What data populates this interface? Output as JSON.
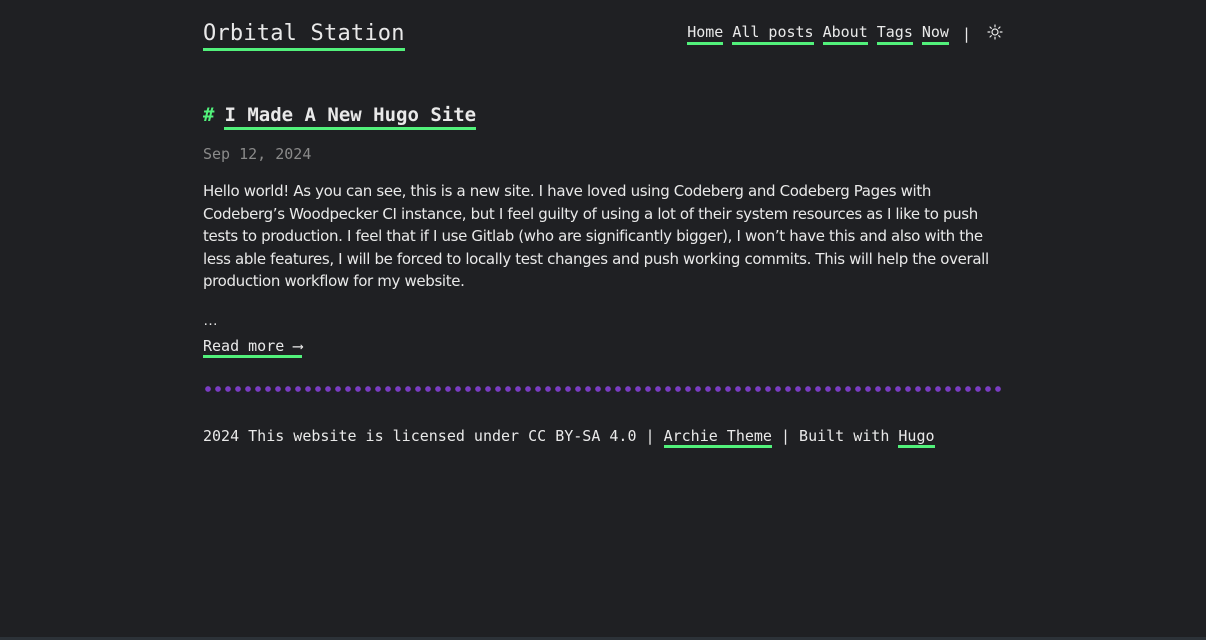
{
  "site": {
    "title": "Orbital Station"
  },
  "nav": {
    "items": [
      "Home",
      "All posts",
      "About",
      "Tags",
      "Now"
    ],
    "separator": "|",
    "theme_icon": "sun-icon"
  },
  "post": {
    "hash": "#",
    "title": "I Made A New Hugo Site",
    "date": "Sep 12, 2024",
    "summary": "Hello world! As you can see, this is a new site. I have loved using Codeberg and Codeberg Pages with Codeberg’s Woodpecker CI instance, but I feel guilty of using a lot of their system resources as I like to push tests to production. I feel that if I use Gitlab (who are significantly bigger), I won’t have this and also with the less able features, I will be forced to locally test changes and push working commits. This will help the overall production workflow for my website.",
    "ellipsis": "…",
    "read_more": "Read more ⟶"
  },
  "footer": {
    "license_text": "2024 This website is licensed under CC BY-SA 4.0 |",
    "theme_link": "Archie Theme",
    "built_with_text": "| Built with",
    "hugo_link": "Hugo"
  },
  "colors": {
    "background": "#1f2023",
    "text": "#e9e9e9",
    "accent": "#52f17b",
    "date": "#8a8a8a",
    "divider": "#7a3cc4"
  }
}
